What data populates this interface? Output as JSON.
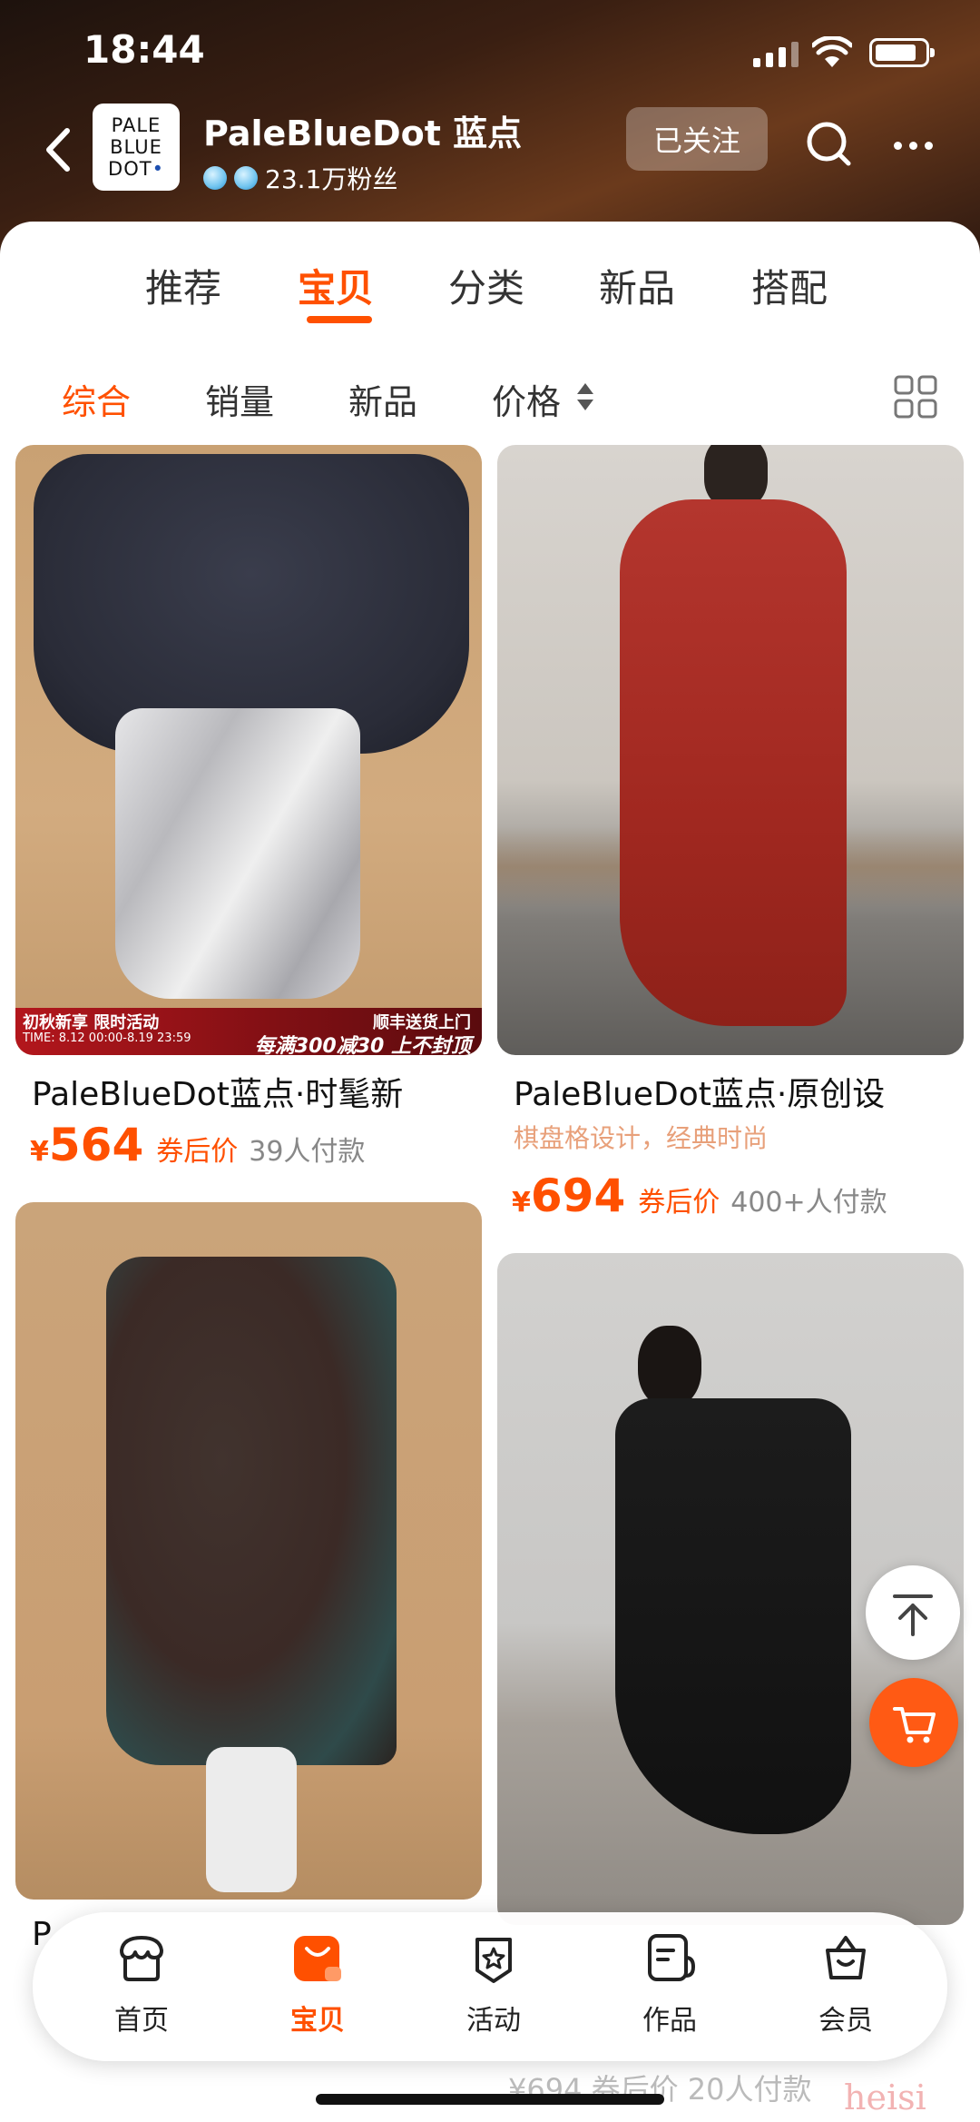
{
  "status_bar": {
    "time": "18:44"
  },
  "header": {
    "logo_lines": [
      "PALE",
      "BLUE",
      "DOT"
    ],
    "shop_name": "PaleBlueDot 蓝点",
    "fans": "23.1万粉丝",
    "follow_label": "已关注"
  },
  "tabs": {
    "items": [
      {
        "label": "推荐"
      },
      {
        "label": "宝贝"
      },
      {
        "label": "分类"
      },
      {
        "label": "新品"
      },
      {
        "label": "搭配"
      }
    ],
    "active_index": 1
  },
  "sort_bar": {
    "items": [
      {
        "label": "综合"
      },
      {
        "label": "销量"
      },
      {
        "label": "新品"
      },
      {
        "label": "价格"
      }
    ],
    "active_index": 0
  },
  "products": [
    {
      "title": "PaleBlueDot蓝点·时髦新",
      "subtitle": "",
      "currency": "¥",
      "price": "564",
      "price_tag": "券后价",
      "sold": "39人付款",
      "banner": {
        "left": "初秋新享 限时活动",
        "time": "TIME: 8.12 00:00-8.19 23:59",
        "right": "顺丰送货上门",
        "promo": "每满300减30 上不封顶"
      }
    },
    {
      "title": "PaleBlueDot蓝点·原创设",
      "subtitle": "棋盘格设计，经典时尚",
      "currency": "¥",
      "price": "694",
      "price_tag": "券后价",
      "sold": "400+人付款"
    },
    {
      "title": "P",
      "subtitle": ""
    },
    {
      "title": "",
      "price_partial": "¥694 券后价 20人付款"
    }
  ],
  "bottom_nav": {
    "items": [
      {
        "label": "首页",
        "icon": "storefront-icon"
      },
      {
        "label": "宝贝",
        "icon": "shopping-bag-icon"
      },
      {
        "label": "活动",
        "icon": "event-star-icon"
      },
      {
        "label": "作品",
        "icon": "works-document-icon"
      },
      {
        "label": "会员",
        "icon": "member-bag-icon"
      }
    ],
    "active_index": 1
  },
  "watermark": "heisi",
  "colors": {
    "accent": "#ff5000",
    "header_bg": "#3a1f12"
  }
}
